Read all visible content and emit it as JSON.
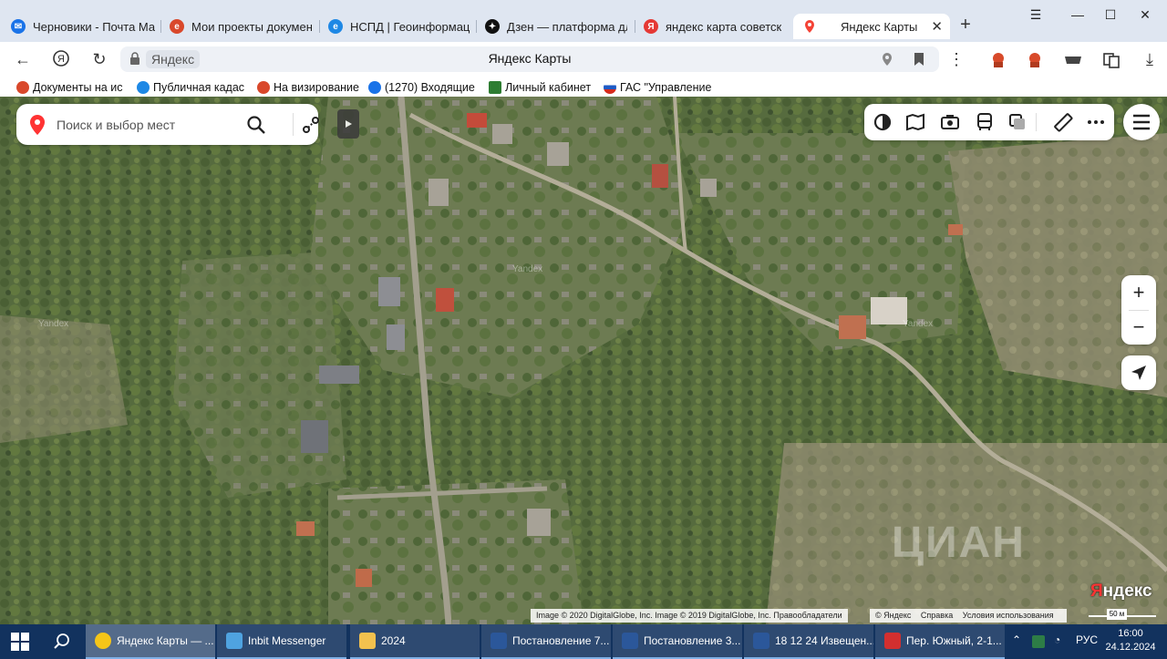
{
  "browser": {
    "tabs": [
      {
        "title": "Черновики - Почта Ма",
        "icon": "mail-icon",
        "color": "#1a73e8"
      },
      {
        "title": "Мои проекты документ",
        "icon": "document-flow-icon",
        "color": "#d9482b"
      },
      {
        "title": "НСПД | Геоинформаци",
        "icon": "nspd-icon",
        "color": "#1e88e5"
      },
      {
        "title": "Дзен — платформа дл",
        "icon": "dzen-icon",
        "color": "#111111"
      },
      {
        "title": "яндекс карта советск",
        "icon": "yandex-icon",
        "color": "#e53935"
      },
      {
        "title": "Яндекс Карты",
        "icon": "map-pin-icon",
        "color": "#f44336"
      }
    ],
    "address": {
      "host": "Яндекс",
      "title": "Яндекс Карты"
    },
    "bookmarks": [
      {
        "label": "Документы на ис",
        "color": "#d9482b"
      },
      {
        "label": "Публичная кадас",
        "color": "#1e88e5"
      },
      {
        "label": "На визирование",
        "color": "#d9482b"
      },
      {
        "label": "(1270) Входящие",
        "color": "#1a73e8"
      },
      {
        "label": "Личный кабинет",
        "color": "#2e7d32"
      },
      {
        "label": "ГАС \"Управление",
        "color": "#d32f2f"
      }
    ]
  },
  "map": {
    "search": {
      "placeholder": "Поиск и выбор мест"
    },
    "zoom": {
      "in": "+",
      "out": "−"
    },
    "copyright": "Image © 2020 DigitalGlobe, Inc. Image © 2019 DigitalGlobe, Inc.   Правообладатели",
    "terms": [
      "© Яндекс",
      "Справка",
      "Условия использования"
    ],
    "logo": {
      "first": "Я",
      "rest": "ндекс"
    },
    "scale": "50 м",
    "watermark": "ЦИАН",
    "map_watermarks": [
      "Yandex",
      "Yandex",
      "Yandex"
    ]
  },
  "taskbar": {
    "apps": [
      {
        "label": "Яндекс Карты — ...",
        "color": "#f5c518",
        "active": true
      },
      {
        "label": "Inbit Messenger",
        "color": "#4fa3e0",
        "active": false
      },
      {
        "label": "2024",
        "color": "#f2c14e",
        "active": false
      },
      {
        "label": "Постановление 7...",
        "color": "#2b579a",
        "active": false
      },
      {
        "label": "Постановление 3...",
        "color": "#2b579a",
        "active": false
      },
      {
        "label": "18 12 24 Извещен...",
        "color": "#2b579a",
        "active": false
      },
      {
        "label": "Пер. Южный, 2-1...",
        "color": "#d32f2f",
        "active": false
      }
    ],
    "lang": "РУС",
    "time": "16:00",
    "date": "24.12.2024"
  }
}
